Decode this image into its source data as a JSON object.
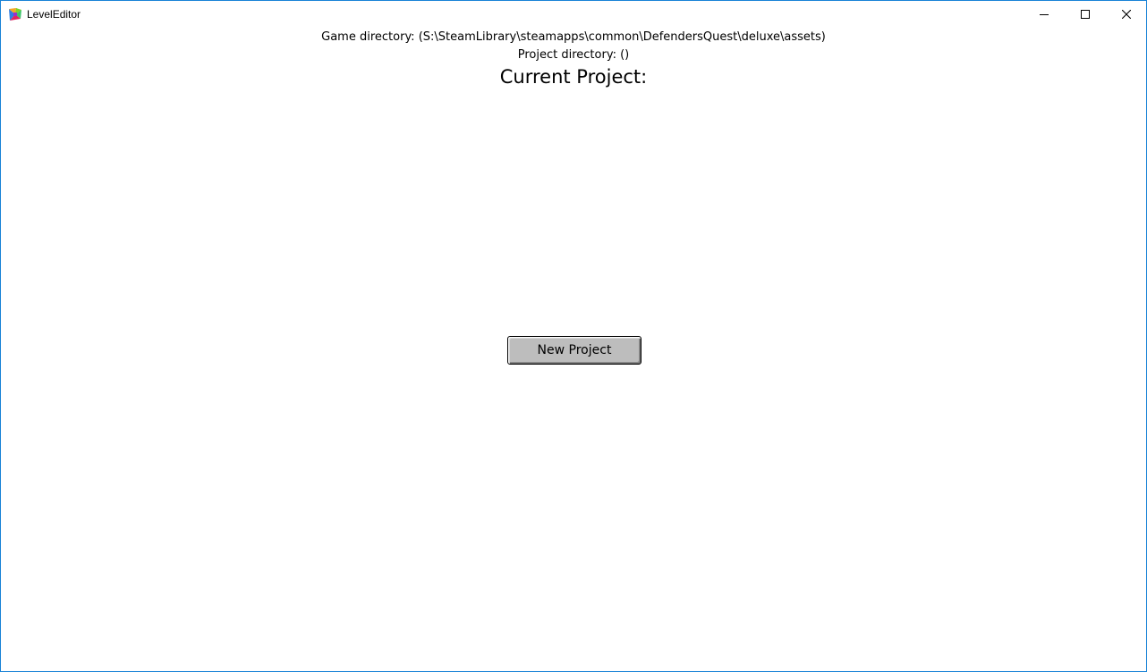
{
  "window": {
    "title": "LevelEditor",
    "icon": "level-editor-app-icon",
    "controls": {
      "minimize": "minimize-icon",
      "maximize": "maximize-icon",
      "close": "close-icon"
    }
  },
  "main": {
    "game_directory": "Game directory: (S:\\SteamLibrary\\steamapps\\common\\DefendersQuest\\deluxe\\assets)",
    "project_directory": "Project directory: ()",
    "current_project": "Current Project:",
    "new_project_label": "New Project"
  },
  "colors": {
    "window_border": "#1883d7",
    "button_face": "#bdbdbd"
  }
}
